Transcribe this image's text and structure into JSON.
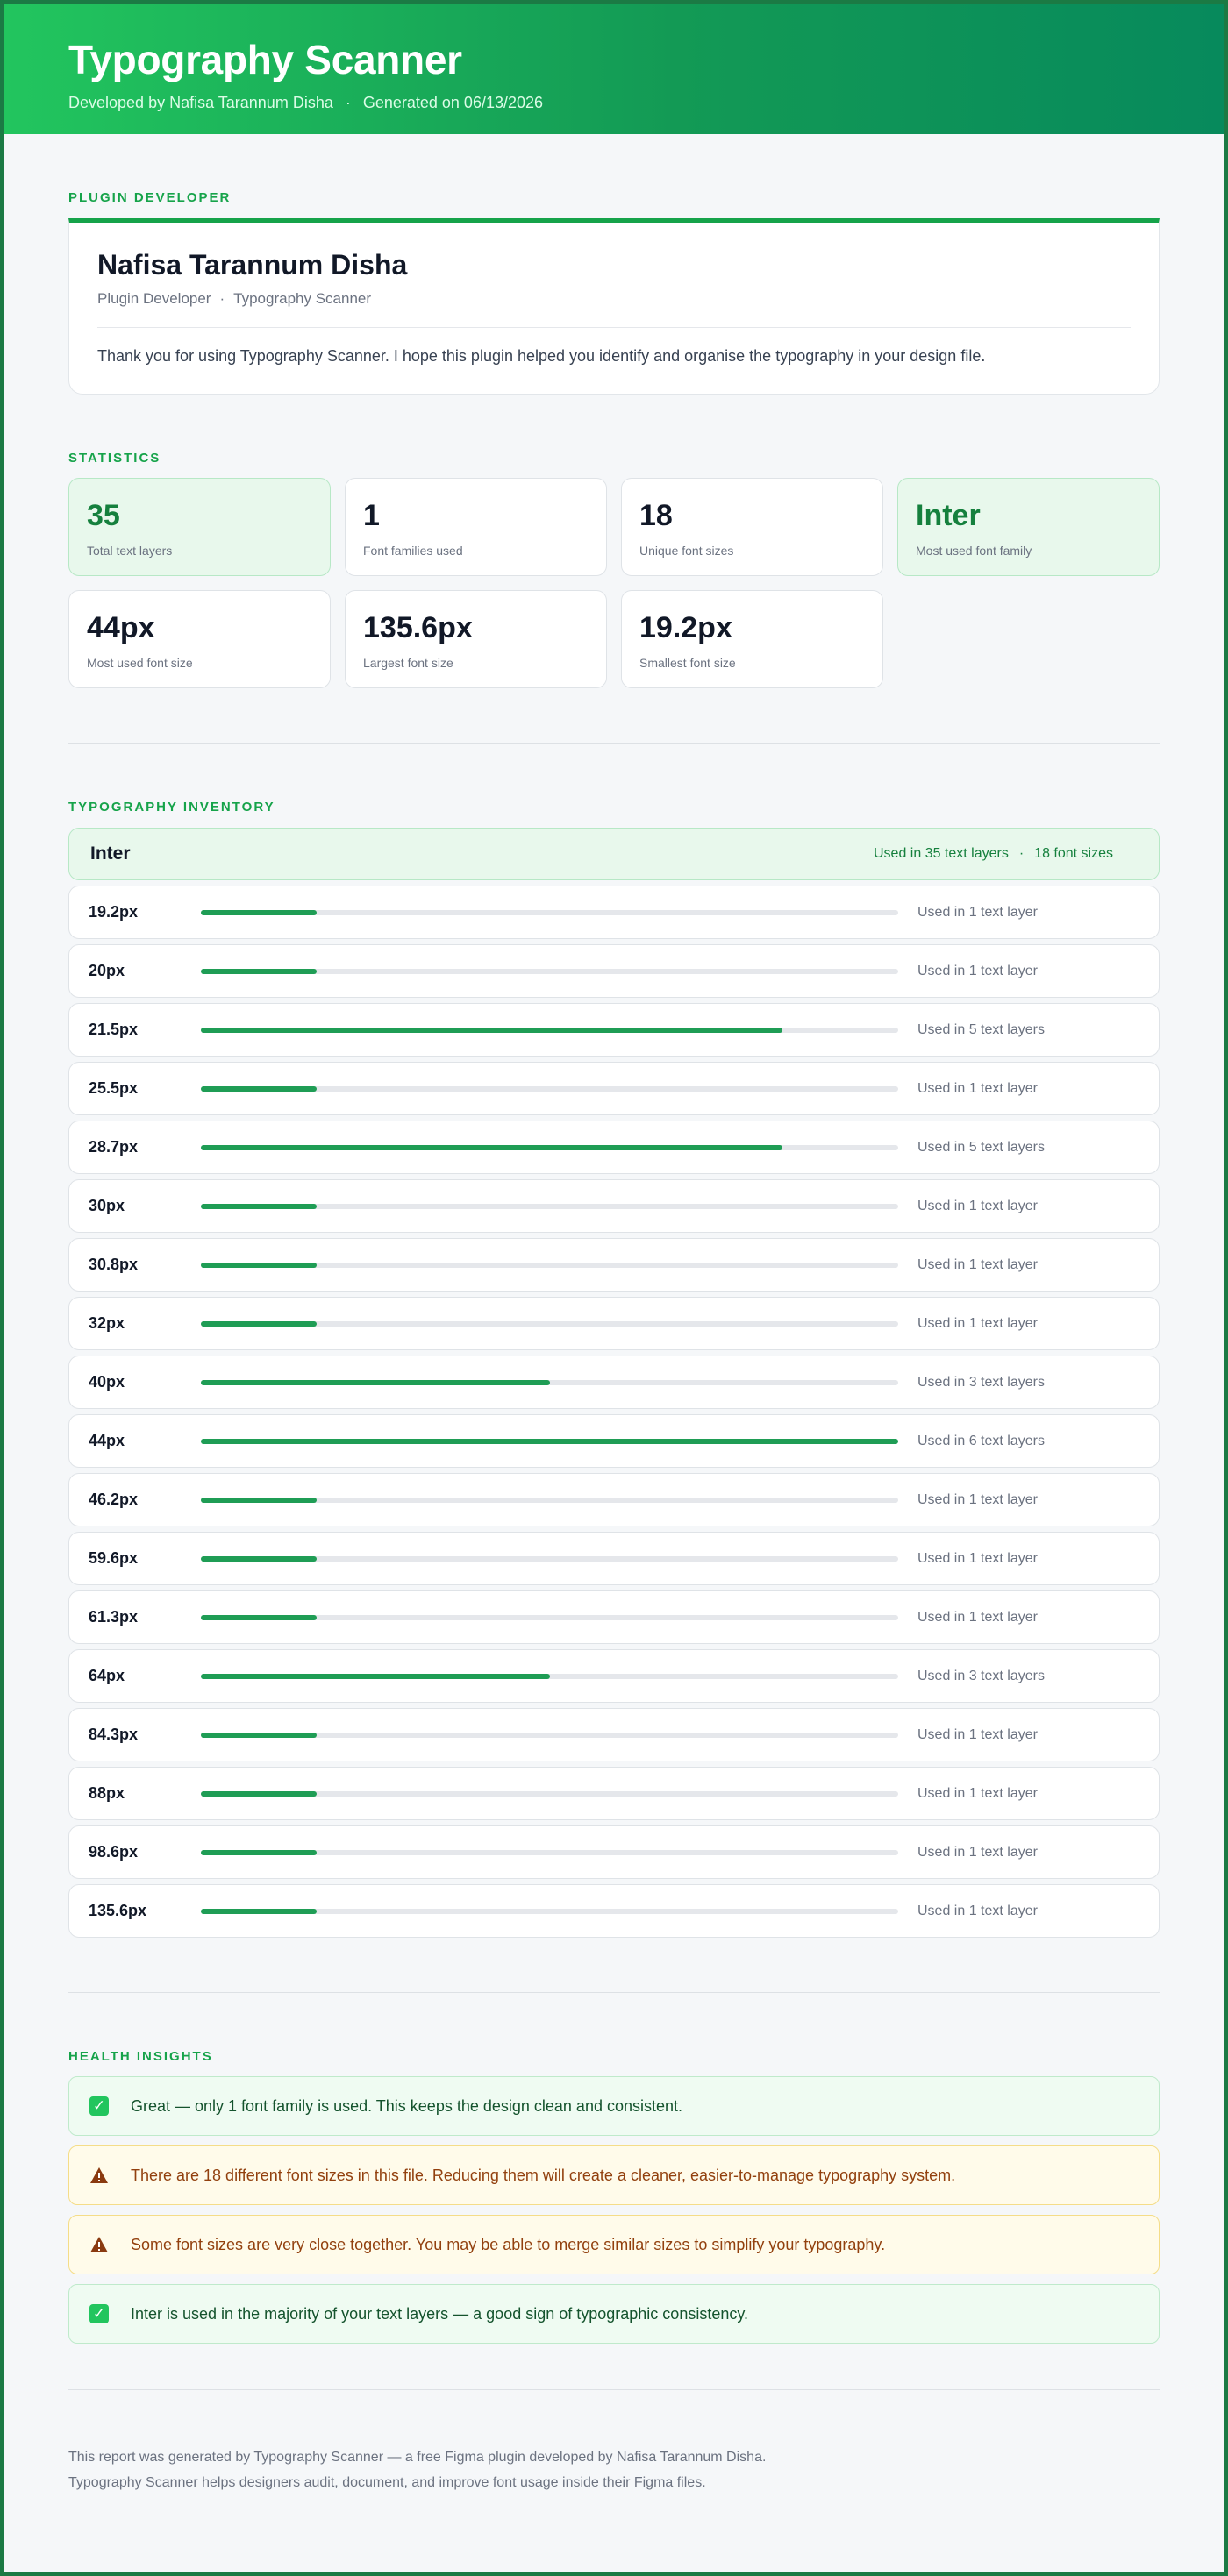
{
  "header": {
    "title": "Typography Scanner",
    "developed_by": "Developed by Nafisa Tarannum Disha",
    "separator": "·",
    "generated": "Generated on 06/13/2026"
  },
  "developer": {
    "section_title": "Plugin Developer",
    "name": "Nafisa Tarannum Disha",
    "role": "Plugin Developer",
    "separator": "·",
    "plugin": "Typography Scanner",
    "message": "Thank you for using Typography Scanner. I hope this plugin helped you identify and organise the typography in your design file."
  },
  "statistics": {
    "section_title": "Statistics",
    "items": [
      {
        "value": "35",
        "label": "Total text layers",
        "highlight": true
      },
      {
        "value": "1",
        "label": "Font families used",
        "highlight": false
      },
      {
        "value": "18",
        "label": "Unique font sizes",
        "highlight": false
      },
      {
        "value": "Inter",
        "label": "Most used font family",
        "highlight": true
      },
      {
        "value": "44px",
        "label": "Most used font size",
        "highlight": false
      },
      {
        "value": "135.6px",
        "label": "Largest font size",
        "highlight": false
      },
      {
        "value": "19.2px",
        "label": "Smallest font size",
        "highlight": false
      }
    ]
  },
  "inventory": {
    "section_title": "Typography Inventory",
    "family": {
      "name": "Inter",
      "used_in": "Used in 35 text layers",
      "separator": "·",
      "sizes": "18 font sizes"
    },
    "rows": [
      {
        "size": "19.2px",
        "count": 1,
        "uses": "Used in 1 text layer"
      },
      {
        "size": "20px",
        "count": 1,
        "uses": "Used in 1 text layer"
      },
      {
        "size": "21.5px",
        "count": 5,
        "uses": "Used in 5 text layers"
      },
      {
        "size": "25.5px",
        "count": 1,
        "uses": "Used in 1 text layer"
      },
      {
        "size": "28.7px",
        "count": 5,
        "uses": "Used in 5 text layers"
      },
      {
        "size": "30px",
        "count": 1,
        "uses": "Used in 1 text layer"
      },
      {
        "size": "30.8px",
        "count": 1,
        "uses": "Used in 1 text layer"
      },
      {
        "size": "32px",
        "count": 1,
        "uses": "Used in 1 text layer"
      },
      {
        "size": "40px",
        "count": 3,
        "uses": "Used in 3 text layers"
      },
      {
        "size": "44px",
        "count": 6,
        "uses": "Used in 6 text layers"
      },
      {
        "size": "46.2px",
        "count": 1,
        "uses": "Used in 1 text layer"
      },
      {
        "size": "59.6px",
        "count": 1,
        "uses": "Used in 1 text layer"
      },
      {
        "size": "61.3px",
        "count": 1,
        "uses": "Used in 1 text layer"
      },
      {
        "size": "64px",
        "count": 3,
        "uses": "Used in 3 text layers"
      },
      {
        "size": "84.3px",
        "count": 1,
        "uses": "Used in 1 text layer"
      },
      {
        "size": "88px",
        "count": 1,
        "uses": "Used in 1 text layer"
      },
      {
        "size": "98.6px",
        "count": 1,
        "uses": "Used in 1 text layer"
      },
      {
        "size": "135.6px",
        "count": 1,
        "uses": "Used in 1 text layer"
      }
    ]
  },
  "insights": {
    "section_title": "Health Insights",
    "items": [
      {
        "type": "ok",
        "icon": "check-icon",
        "text": "Great — only 1 font family is used. This keeps the design clean and consistent."
      },
      {
        "type": "warn",
        "icon": "warning-icon",
        "text": "There are 18 different font sizes in this file. Reducing them will create a cleaner, easier-to-manage typography system."
      },
      {
        "type": "warn",
        "icon": "warning-icon",
        "text": "Some font sizes are very close together. You may be able to merge similar sizes to simplify your typography."
      },
      {
        "type": "ok",
        "icon": "check-icon",
        "text": "Inter is used in the majority of your text layers — a good sign of typographic consistency."
      }
    ]
  },
  "footer": {
    "line1": "This report was generated by Typography Scanner — a free Figma plugin developed by Nafisa Tarannum Disha.",
    "line2": "Typography Scanner helps designers audit, document, and improve font usage inside their Figma files."
  },
  "colors": {
    "accent": "#16a34a",
    "bar": "#1f9d55",
    "warn_text": "#92400e"
  }
}
